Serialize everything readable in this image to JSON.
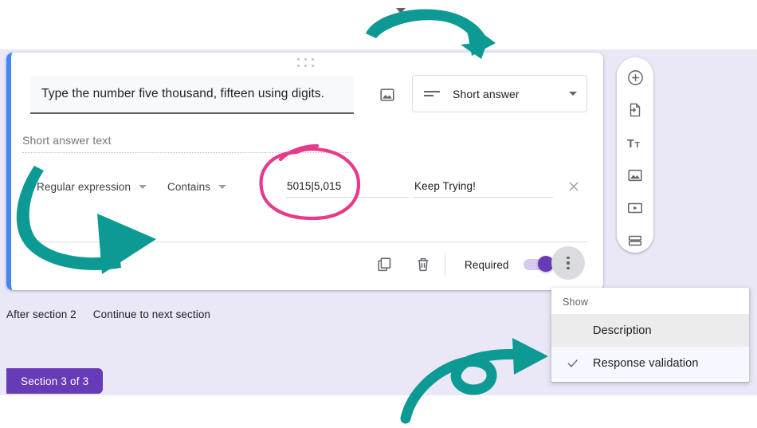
{
  "colors": {
    "accent_purple": "#673AB7",
    "card_accent_blue": "#4285F4",
    "page_background": "#EAE7F7",
    "annotation_teal": "#0D9A94",
    "annotation_pink": "#E8398A"
  },
  "card": {
    "drag_handle_icon": "drag-dots-icon",
    "question_text": "Type the number five thousand, fifteen using digits.",
    "image_button_icon": "image-icon",
    "type_select": {
      "leading_icon": "short-answer-lines-icon",
      "value": "Short answer",
      "caret_icon": "chevron-down-icon"
    },
    "short_answer_placeholder": "Short answer text",
    "validation": {
      "type": "Regular expression",
      "condition": "Contains",
      "pattern": "5015|5,015",
      "error_message": "Keep Trying!",
      "remove_icon": "close-icon"
    },
    "footer": {
      "duplicate_icon": "duplicate-icon",
      "delete_icon": "trash-icon",
      "required_label": "Required",
      "required_on": true,
      "more_options_icon": "kebab-menu-icon"
    }
  },
  "after_section": {
    "label": "After section 2",
    "value": "Continue to next section",
    "caret_icon": "chevron-down-icon"
  },
  "section_badge": {
    "label": "Section 3 of 3"
  },
  "right_toolbar": {
    "items": [
      {
        "icon": "add-circle-icon",
        "name": "add-question-button"
      },
      {
        "icon": "import-questions-icon",
        "name": "import-questions-button"
      },
      {
        "icon": "title-description-icon",
        "name": "add-title-button"
      },
      {
        "icon": "image-icon",
        "name": "add-image-button"
      },
      {
        "icon": "video-icon",
        "name": "add-video-button"
      },
      {
        "icon": "section-icon",
        "name": "add-section-button"
      }
    ]
  },
  "menu": {
    "header": "Show",
    "items": [
      {
        "label": "Description",
        "checked": false,
        "state": "hover"
      },
      {
        "label": "Response validation",
        "checked": true,
        "state": "selected"
      }
    ],
    "check_icon": "check-icon"
  },
  "annotations": [
    {
      "name": "teal-arrow-top",
      "shape": "curved-arrow-right-down"
    },
    {
      "name": "teal-arrow-left",
      "shape": "curved-arrow-right"
    },
    {
      "name": "teal-arrow-bottom",
      "shape": "looped-arrow-right"
    },
    {
      "name": "pink-ellipse",
      "shape": "hand-drawn-ellipse"
    }
  ]
}
